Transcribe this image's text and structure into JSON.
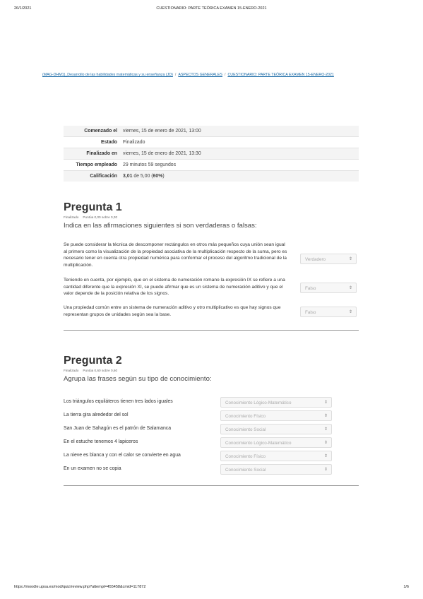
{
  "print_header": {
    "date": "26/1/2021",
    "title": "CUESTIONARIO: PARTE TEÓRICA EXAMEN 15-ENERO-2021"
  },
  "breadcrumb": [
    "(MAG-DHM1)_Desarrollo de las habilidades matemáticas y su enseñanza (JD)",
    "ASPECTOS GENERALES",
    "CUESTIONARIO: PARTE TEÓRICA EXAMEN 15-ENERO-2021"
  ],
  "summary": [
    {
      "key": "Comenzado el",
      "value": "viernes, 15 de enero de 2021, 13:00"
    },
    {
      "key": "Estado",
      "value": "Finalizado"
    },
    {
      "key": "Finalizado en",
      "value": "viernes, 15 de enero de 2021, 13:30"
    },
    {
      "key": "Tiempo empleado",
      "value": "29 minutos 59 segundos"
    },
    {
      "key": "Calificación",
      "value_bold": "3,01",
      "value_mid": " de 5,00 (",
      "value_pct": "60%",
      "value_end": ")"
    }
  ],
  "q1": {
    "title": "Pregunta 1",
    "status": "Finalizado",
    "score": "Puntúa 0,00 sobre 0,30",
    "prompt": "Indica en las afirmaciones siguientes si son verdaderas o falsas:",
    "items": [
      {
        "text": "Se puede considerar la técnica de descomponer rectángulos en otros más pequeños cuya unión sean igual al primero como la visualización de la propiedad asociativa de la multiplicación respecto de la suma, pero es necesario tener en cuenta otra propiedad numérica para conformar el proceso del algoritmo tradicional de la multiplicación.",
        "answer": "Verdadero"
      },
      {
        "text": "Teniendo en cuenta, por ejemplo, que en el sistema de numeración romano la expresión IX se refiere a una cantidad diferente que la expresión XI, se puede afirmar que es un sistema de numeración aditivo y que el valor depende de la posición relativa de los signos.",
        "answer": "Falso"
      },
      {
        "text": "Una propiedad común entre un sistema de numeración aditivo y otro multiplicativo es que hay signos que representan grupos de unidades según sea la base.",
        "answer": "Falso"
      }
    ]
  },
  "q2": {
    "title": "Pregunta 2",
    "status": "Finalizado",
    "score": "Puntúa 0,60 sobre 0,60",
    "prompt": "Agrupa las frases según su tipo de conocimiento:",
    "items": [
      {
        "text": "Los triángulos equiláteros tienen tres lados iguales",
        "answer": "Conocimiento Lógico-Matemático"
      },
      {
        "text": "La tierra gira alrededor del sol",
        "answer": "Conocimiento Físico"
      },
      {
        "text": "San Juan de Sahagún es el patrón de Salamanca",
        "answer": "Conocimiento Social"
      },
      {
        "text": "En el estuche tenemos 4 lapiceros",
        "answer": "Conocimiento Lógico-Matemático"
      },
      {
        "text": "La nieve es blanca y con el calor se convierte en agua",
        "answer": "Conocimiento Físico"
      },
      {
        "text": "En un examen no se copia",
        "answer": "Conocimiento Social"
      }
    ]
  },
  "select_chevron": "⇕",
  "print_footer": {
    "url": "https://moodle.upsa.es/mod/quiz/review.php?attempt=455458&cmid=117872",
    "page": "1/6"
  }
}
